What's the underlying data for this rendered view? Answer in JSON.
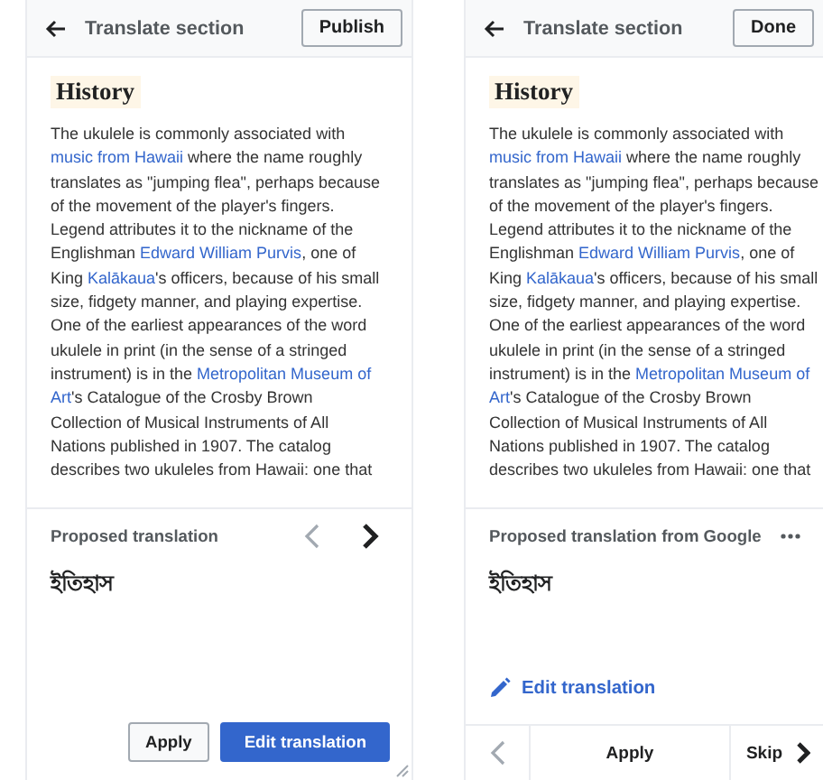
{
  "screens": [
    {
      "kind": "card",
      "header": {
        "title": "Translate section",
        "action": "Publish"
      },
      "heading": "History",
      "paragraph": [
        {
          "text": "The ukulele is commonly associated with ",
          "link": false
        },
        {
          "text": "music from Hawaii",
          "link": true
        },
        {
          "text": " where the name roughly translates as \"jumping flea\", perhaps because of the movement of the player's fingers. Legend attributes it to the nickname of the Englishman ",
          "link": false
        },
        {
          "text": "Edward William Purvis",
          "link": true
        },
        {
          "text": ", one of King ",
          "link": false
        },
        {
          "text": "Kalākaua",
          "link": true
        },
        {
          "text": "'s officers, because of his small size, fidgety manner, and playing expertise. One of the earliest appearances of the word ukulele in print (in the sense of a stringed instrument) is in the ",
          "link": false
        },
        {
          "text": "Metropolitan Museum of",
          "link": true
        },
        {
          "text": "Art",
          "link": true,
          "space_before": true
        },
        {
          "text": "'s Catalogue of the Crosby Brown Collection of Musical Instruments of All Nations published in 1907. The catalog describes two ukuleles from Hawaii: one that",
          "link": false
        }
      ],
      "proposal": {
        "label": "Proposed translation",
        "text": "ইতিহাস",
        "previous_disabled": true,
        "next_disabled": false
      },
      "buttons": [
        {
          "label": "Apply",
          "primary": false
        },
        {
          "label": "Edit translation",
          "primary": true
        }
      ]
    },
    {
      "kind": "sheet",
      "header": {
        "title": "Translate section",
        "action": "Done"
      },
      "heading": "History",
      "paragraph": [
        {
          "text": "The ukulele is commonly associated with ",
          "link": false
        },
        {
          "text": "music from Hawaii",
          "link": true
        },
        {
          "text": " where the name roughly translates as \"jumping flea\", perhaps because of the movement of the player's fingers. Legend attributes it to the nickname of the Englishman ",
          "link": false
        },
        {
          "text": "Edward William Purvis",
          "link": true
        },
        {
          "text": ", one of King ",
          "link": false
        },
        {
          "text": "Kalākaua",
          "link": true
        },
        {
          "text": "'s officers, because of his small size, fidgety manner, and playing expertise. One of the earliest appearances of the word ukulele in print (in the sense of a stringed instrument) is in the ",
          "link": false
        },
        {
          "text": "Metropolitan Museum of",
          "link": true
        },
        {
          "text": "Art",
          "link": true,
          "space_before": true
        },
        {
          "text": "'s Catalogue of the Crosby Brown Collection of Musical Instruments of All Nations published in 1907. The catalog describes two ukuleles from Hawaii: one that",
          "link": false
        }
      ],
      "proposal": {
        "label": "Proposed translation from Google",
        "text": "ইতিহাস",
        "previous_disabled": true
      },
      "edit_link": "Edit translation",
      "bottom_bar": {
        "apply": "Apply",
        "skip": "Skip"
      }
    }
  ]
}
